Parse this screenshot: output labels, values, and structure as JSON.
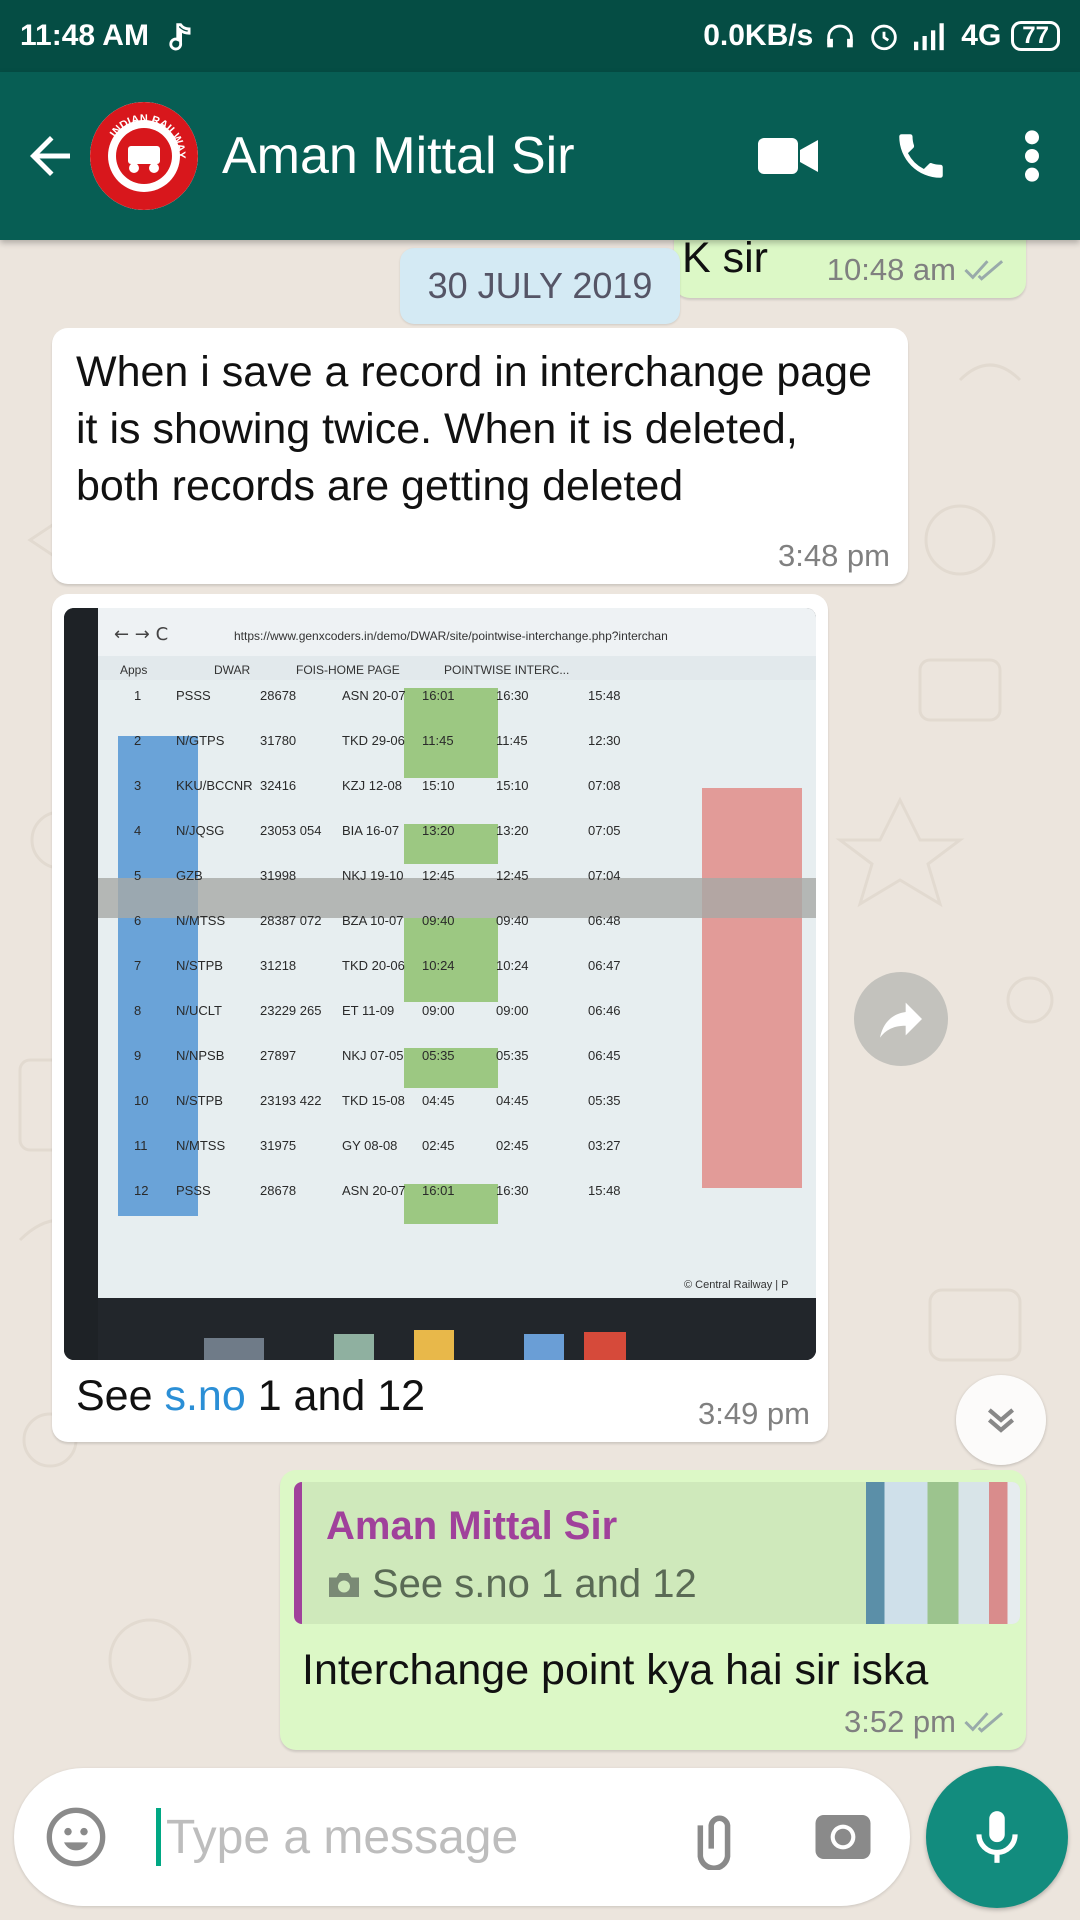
{
  "status_bar": {
    "time": "11:48 AM",
    "speed": "0.0KB/s",
    "network": "4G",
    "battery": "77"
  },
  "header": {
    "contact_name": "Aman Mittal Sir",
    "avatar_text": "INDIAN RAILWAYS"
  },
  "chat": {
    "partial_message": {
      "text": "K sir",
      "time": "10:48 am"
    },
    "date_chip": "30 JULY 2019",
    "messages": [
      {
        "text": "When i save a record in interchange page it is showing twice. When it is deleted, both records are getting deleted",
        "time": "3:48 pm"
      },
      {
        "caption_prefix": "See ",
        "caption_link": "s.no",
        "caption_suffix": " 1 and 12",
        "time": "3:49 pm"
      },
      {
        "reply_name": "Aman Mittal Sir",
        "reply_text": "See s.no 1 and 12",
        "text": "Interchange point kya hai sir iska",
        "time": "3:52 pm"
      }
    ]
  },
  "screenshot_photo": {
    "url": "https://www.genxcoders.in/demo/DWAR/site/pointwise-interchange.php?interchan",
    "bookmarks": [
      "Apps",
      "DWAR",
      "FOIS-HOME PAGE",
      "POINTWISE INTERC..."
    ],
    "rows": [
      [
        "1",
        "PSSS",
        "28678",
        "ASN 20-07",
        "16:01",
        "16:30",
        "15:48"
      ],
      [
        "2",
        "N/GTPS",
        "31780",
        "TKD 29-06",
        "11:45",
        "11:45",
        "12:30"
      ],
      [
        "3",
        "KKU/BCCNR",
        "32416",
        "KZJ 12-08",
        "15:10",
        "15:10",
        "07:08"
      ],
      [
        "4",
        "N/JQSG",
        "23053 054",
        "BIA 16-07",
        "13:20",
        "13:20",
        "07:05"
      ],
      [
        "5",
        "GZB",
        "31998",
        "NKJ 19-10",
        "12:45",
        "12:45",
        "07:04"
      ],
      [
        "6",
        "N/MTSS",
        "28387 072",
        "BZA 10-07",
        "09:40",
        "09:40",
        "06:48"
      ],
      [
        "7",
        "N/STPB",
        "31218",
        "TKD 20-06",
        "10:24",
        "10:24",
        "06:47"
      ],
      [
        "8",
        "N/UCLT",
        "23229 265",
        "ET 11-09",
        "09:00",
        "09:00",
        "06:46"
      ],
      [
        "9",
        "N/NPSB",
        "27897",
        "NKJ 07-05",
        "05:35",
        "05:35",
        "06:45"
      ],
      [
        "10",
        "N/STPB",
        "23193 422",
        "TKD 15-08",
        "04:45",
        "04:45",
        "05:35"
      ],
      [
        "11",
        "N/MTSS",
        "31975",
        "GY 08-08",
        "02:45",
        "02:45",
        "03:27"
      ],
      [
        "12",
        "PSSS",
        "28678",
        "ASN 20-07",
        "16:01",
        "16:30",
        "15:48"
      ]
    ],
    "footer": "© Central Railway | P"
  },
  "input": {
    "placeholder": "Type a message"
  }
}
